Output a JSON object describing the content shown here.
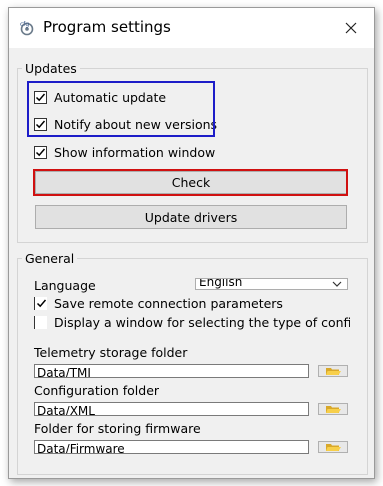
{
  "window": {
    "title": "Program settings",
    "app_icon": "cfg-app-icon",
    "close_icon": "close-icon"
  },
  "updates": {
    "legend": "Updates",
    "automatic_update": {
      "label": "Automatic update",
      "checked": true
    },
    "notify_new_versions": {
      "label": "Notify about new versions",
      "checked": true
    },
    "show_info_window": {
      "label": "Show information window",
      "checked": true
    },
    "check_button": "Check",
    "update_drivers_button": "Update drivers"
  },
  "general": {
    "legend": "General",
    "language_label": "Language",
    "language_value": "English",
    "save_remote": {
      "label": "Save remote connection parameters",
      "checked": true
    },
    "display_window": {
      "label": "Display a window for selecting the type of configura",
      "checked": false
    },
    "telemetry_label": "Telemetry storage folder",
    "telemetry_value": "Data/TMI",
    "config_label": "Configuration folder",
    "config_value": "Data/XML",
    "firmware_label": "Folder for storing firmware",
    "firmware_value": "Data/Firmware",
    "folder_icon": "folder-open-icon"
  },
  "colors": {
    "highlight_blue": "#1c1cc8",
    "highlight_red": "#d01010"
  }
}
